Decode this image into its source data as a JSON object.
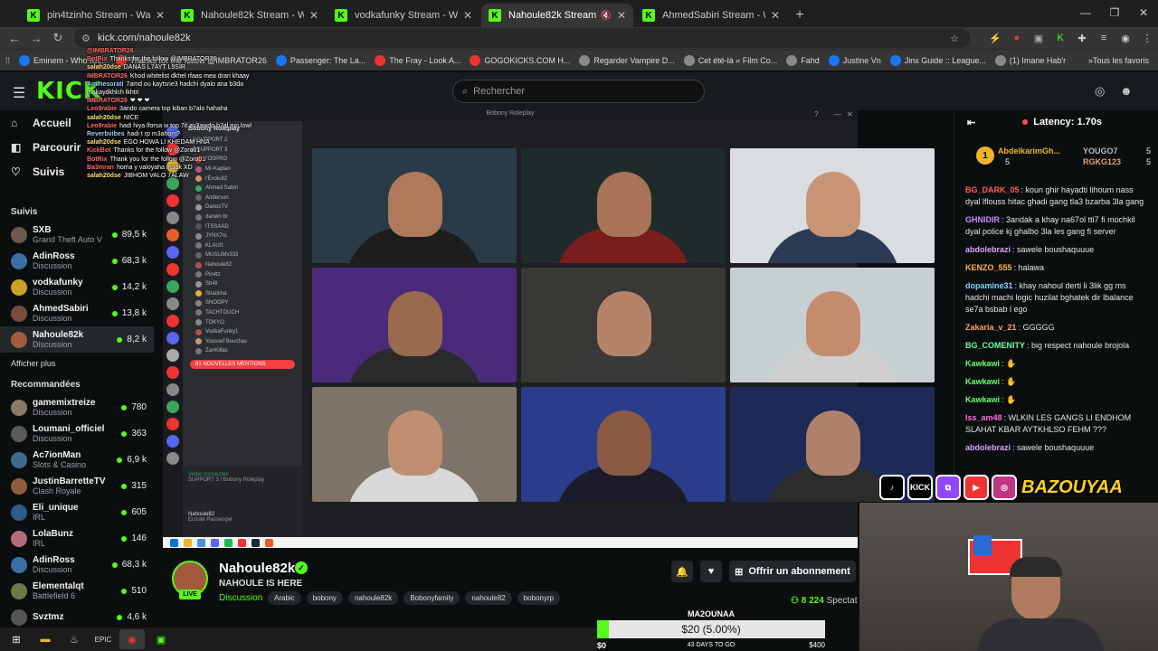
{
  "browser": {
    "tabs": [
      {
        "title": "pin4tzinho Stream - Watch Live",
        "active": false
      },
      {
        "title": "Nahoule82k Stream - Watch Live",
        "active": false
      },
      {
        "title": "vodkafunky Stream - Watch Live",
        "active": false
      },
      {
        "title": "Nahoule82k Stream - Watch",
        "active": true
      },
      {
        "title": "AhmedSabiri Stream - Watch Live",
        "active": false
      }
    ],
    "url": "kick.com/nahoule82k",
    "bookmarks": [
      "Eminem - Who Kn...",
      "Thanks for the follow @IMBRATOR26",
      "Passenger: The La...",
      "The Fray - Look A...",
      "GOGOKICKS.COM H...",
      "Regarder Vampire D...",
      "Cet été-là « Film Co...",
      "Fahd",
      "Justine Vn",
      "Jinx Guide :: League...",
      "(1) Imane Hab'r"
    ],
    "bookmarks_all": "Tous les favoris"
  },
  "header": {
    "logo": "KICK",
    "search_placeholder": "Rechercher"
  },
  "sidebar": {
    "nav": [
      {
        "label": "Accueil",
        "icon": "⌂"
      },
      {
        "label": "Parcourir",
        "icon": "◧"
      },
      {
        "label": "Suivis",
        "icon": "♡"
      }
    ],
    "followed_title": "Suivis",
    "followed": [
      {
        "name": "SXB",
        "category": "Grand Theft Auto V",
        "viewers": "89,5 k",
        "color": "#6b5a4e"
      },
      {
        "name": "AdinRoss",
        "category": "Discussion",
        "viewers": "68,3 k",
        "color": "#3a6ea5"
      },
      {
        "name": "vodkafunky",
        "category": "Discussion",
        "viewers": "14,2 k",
        "color": "#c9a227"
      },
      {
        "name": "AhmedSabiri",
        "category": "Discussion",
        "viewers": "13,8 k",
        "color": "#7a4b3a"
      },
      {
        "name": "Nahoule82k",
        "category": "Discussion",
        "viewers": "8,2 k",
        "color": "#a35a3c"
      }
    ],
    "show_more": "Afficher plus",
    "recommended_title": "Recommandées",
    "recommended": [
      {
        "name": "gamemixtreize",
        "category": "Discussion",
        "viewers": "780",
        "color": "#8a7a66"
      },
      {
        "name": "Loumani_officiel",
        "category": "Discussion",
        "viewers": "363",
        "color": "#5a5a5a"
      },
      {
        "name": "Ac7ionMan",
        "category": "Slots & Casino",
        "viewers": "6,9 k",
        "color": "#3d6b8f"
      },
      {
        "name": "JustinBarretteTV",
        "category": "Clash Royale",
        "viewers": "315",
        "color": "#8f5d3d"
      },
      {
        "name": "Eli_unique",
        "category": "IRL",
        "viewers": "605",
        "color": "#2f5a8a"
      },
      {
        "name": "LolaBunz",
        "category": "IRL",
        "viewers": "146",
        "color": "#b56b7a"
      },
      {
        "name": "AdinRoss",
        "category": "Discussion",
        "viewers": "68,3 k",
        "color": "#3a6ea5"
      },
      {
        "name": "Elementalqt",
        "category": "Battlefield 6",
        "viewers": "510",
        "color": "#6a7b4a"
      },
      {
        "name": "Svztmz",
        "category": "",
        "viewers": "4,6 k",
        "color": "#555"
      }
    ]
  },
  "stream": {
    "discord_title": "Bobony Roleplay",
    "server": "Bobony Roleplay",
    "voice_channels": [
      "SUPPORT 2",
      "SUPPORT 3"
    ],
    "members": [
      "l'OSPRO",
      "Mr-Kaplan",
      "l'Evolu82",
      "Ahmed Sabiri",
      "Anderson",
      "DanosTV",
      "darwin br",
      "ITSSAAD",
      "JYNX7rs",
      "KLAUS",
      "MUSLIMx333",
      "Nahoule82",
      "Pin4tz",
      "Sb4li",
      "Shaolina",
      "SNOOPY",
      "TACHTOUCH",
      "TOKYO",
      "VodkaFunky1",
      "Youssef Bouchas",
      "ZanKillas"
    ],
    "mentions": "81 NOUVELLES MENTIONS",
    "voice_status": "Vidéo connectée",
    "voice_sub": "SUPPORT 3 / Bobony Roleplay",
    "self_user": "Nahoule82",
    "self_status": "Ecoute Passenger",
    "cams": [
      {
        "bg": "#2b3a47",
        "skin": "#b07a5a",
        "shirt": "#1d1d1d"
      },
      {
        "bg": "#1f2b2a",
        "skin": "#a87356",
        "shirt": "#7a1d1d"
      },
      {
        "bg": "#d9dde0",
        "skin": "#c99476",
        "shirt": "#2b3a55"
      },
      {
        "bg": "#4a2a7a",
        "skin": "#9a6a4e",
        "shirt": "#2a2a2a"
      },
      {
        "bg": "#3a3835",
        "skin": "#b58468",
        "shirt": "#3a3a3a"
      },
      {
        "bg": "#c8cfd3",
        "skin": "#c48c6c",
        "shirt": "#cfcfcf"
      },
      {
        "bg": "#7e7368",
        "skin": "#c08f72",
        "shirt": "#d8d8d8"
      },
      {
        "bg": "#2a3d8a",
        "skin": "#8a5a44",
        "shirt": "#1b1b2a"
      },
      {
        "bg": "#1d2a55",
        "skin": "#b0806a",
        "shirt": "#2c2c2c"
      }
    ],
    "overlay_chat": [
      {
        "user": "@IMBRATOR26",
        "text": "",
        "c": "u"
      },
      {
        "user": "BotRix",
        "text": "Thanks for the follow @IMBRATOR26",
        "c": "u"
      },
      {
        "user": "salah20dse",
        "text": "DANAS L7AYT L9SIR",
        "c": "u2"
      },
      {
        "user": "IMBRATOR26",
        "text": "Khod whitelist dkhel rfaas mea drari khaay",
        "c": "u"
      },
      {
        "user": "Aminesorati",
        "text": "7amd ou kaytsne3 hadchi dyalo ana b3da makaydkhlch lkhtri",
        "c": "u3"
      },
      {
        "user": "IMBRATOR26",
        "text": "❤ ❤ ❤",
        "c": "u"
      },
      {
        "user": "Leo9rabie",
        "text": "3ando camera top kiban b7alo hahaha",
        "c": "u"
      },
      {
        "user": "salah20dse",
        "text": "NICE",
        "c": "u2"
      },
      {
        "user": "Leo9rabie",
        "text": "hadi hiya lforsa w top 7it ay3awdo b7al mn lowl",
        "c": "u"
      },
      {
        "user": "Reverbvibes",
        "text": "hadi t rp m3ahom?",
        "c": "u3"
      },
      {
        "user": "salah20dse",
        "text": "EGO HOWA LI KHEDAM HNA",
        "c": "u2"
      },
      {
        "user": "KickBot",
        "text": "Thanks for the follow @Zoro01",
        "c": "u"
      },
      {
        "user": "BotRix",
        "text": "Thank you for the follow @Zoro01",
        "c": "u"
      },
      {
        "user": "Ba3mran",
        "text": "homa y valoyaha m3ak XD",
        "c": "u"
      },
      {
        "user": "salah20dse",
        "text": "JIBHOM VALO 7ALAW",
        "c": "u2"
      }
    ]
  },
  "info": {
    "name": "Nahoule82k",
    "title": "NAHOULE IS HERE",
    "live": "LIVE",
    "category": "Discussion",
    "tags": [
      "Arabic",
      "bobony",
      "nahoule82k",
      "Bobonyfamily",
      "nahoule82",
      "bobonyrp"
    ],
    "subscribe": "Offrir un abonnement",
    "viewers": "8 224",
    "viewers_label": "Spectat"
  },
  "goal": {
    "title": "MA2OUNAA",
    "amount": "$20 (5.00%)",
    "progress": 0.05,
    "min": "$0",
    "max": "$400",
    "days": "43 DAYS TO GO"
  },
  "chat": {
    "latency": "Latency: 1.70s",
    "pinned": [
      {
        "name": "AbdelkarimGh...",
        "count": "5",
        "rank": "1"
      },
      {
        "name": "YOUGO7",
        "count": "5"
      },
      {
        "name": "RGKG123",
        "count": "5"
      }
    ],
    "messages": [
      {
        "user": "BG_DARK_05",
        "color": "#ff5c5c",
        "text": ": koun ghir hayadti lihoum nass dyal lflouss hitac ghadi gang tla3 bzarba 3la gang"
      },
      {
        "user": "GHNIDIR",
        "color": "#c98bff",
        "text": ": 3andak a khay na67ol tti7 fi mochkil dyal police kj ghalbo 3la les gang fi server"
      },
      {
        "user": "abdolebrazi",
        "color": "#d9a6ff",
        "text": ": sawele boushaquuue"
      },
      {
        "user": "KENZO_555",
        "color": "#ffb347",
        "text": ": halawa"
      },
      {
        "user": "dopamine31",
        "color": "#7fd4ff",
        "text": ": khay nahoul derti li 3lik gg ms hadchi machi logic huzilat bghatek dir lbalance se7a bsbab l ego"
      },
      {
        "user": "Zakaria_v_21",
        "color": "#ff9f6b",
        "text": ": GGGGG"
      },
      {
        "user": "BG_COMENITY",
        "color": "#6bff9f",
        "text": ": big respect nahoule brojola"
      },
      {
        "user": "Kawkawi",
        "color": "#6bff6b",
        "text": ": ✋"
      },
      {
        "user": "Kawkawi",
        "color": "#6bff6b",
        "text": ": ✋"
      },
      {
        "user": "Kawkawi",
        "color": "#6bff6b",
        "text": ": ✋"
      },
      {
        "user": "Iss_am48",
        "color": "#ff6bd4",
        "text": ": WLKIN LES GANGS LI ENDHOM SLAHAT KBAR AYTKHLSO FEHM ???"
      },
      {
        "user": "abdolebrazi",
        "color": "#d9a6ff",
        "text": ": sawele boushaquuue"
      }
    ]
  },
  "social": {
    "brand": "BAZOUYAA",
    "icons": [
      "♪",
      "KICK",
      "⧉",
      "▶",
      "◎"
    ]
  }
}
